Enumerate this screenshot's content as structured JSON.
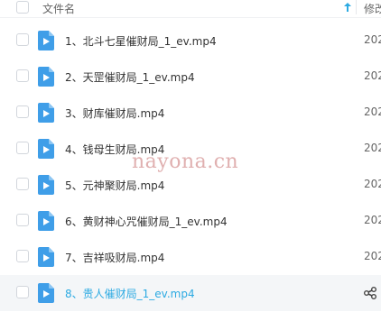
{
  "header": {
    "name_label": "文件名",
    "modified_label": "修改"
  },
  "files": [
    {
      "name": "1、北斗七星催财局_1_ev.mp4",
      "modified": "202"
    },
    {
      "name": "2、天罡催财局_1_ev.mp4",
      "modified": "202"
    },
    {
      "name": "3、财库催财局.mp4",
      "modified": "202"
    },
    {
      "name": "4、钱母生财局.mp4",
      "modified": "202"
    },
    {
      "name": "5、元神聚财局.mp4",
      "modified": "202"
    },
    {
      "name": "6、黄财神心咒催财局_1_ev.mp4",
      "modified": "202"
    },
    {
      "name": "7、吉祥吸财局.mp4",
      "modified": "202"
    },
    {
      "name": "8、贵人催财局_1_ev.mp4",
      "modified": ""
    }
  ],
  "watermark": "nayona.cn",
  "colors": {
    "icon_blue": "#3f9ee8",
    "hover_text": "#2caae2",
    "watermark": "#e0b0b0"
  }
}
